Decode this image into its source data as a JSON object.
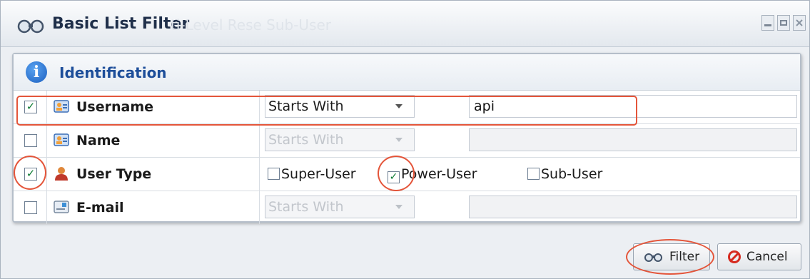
{
  "window": {
    "title": "Basic List Filter",
    "background_title": "ti-Level Rese Sub-User"
  },
  "section": {
    "title": "Identification",
    "icon": "info-icon"
  },
  "rows": [
    {
      "label": "Username",
      "checked": true,
      "icon": "user-card-icon",
      "operator": "Starts With",
      "value": "api",
      "enabled": true
    },
    {
      "label": "Name",
      "checked": false,
      "icon": "user-card-icon",
      "operator": "Starts With",
      "value": "",
      "enabled": false
    },
    {
      "label": "User Type",
      "checked": true,
      "icon": "person-icon",
      "options": [
        {
          "label": "Super-User",
          "checked": false
        },
        {
          "label": "Power-User",
          "checked": true
        },
        {
          "label": "Sub-User",
          "checked": false
        }
      ]
    },
    {
      "label": "E-mail",
      "checked": false,
      "icon": "email-icon",
      "operator": "Starts With",
      "value": "",
      "enabled": false
    }
  ],
  "buttons": {
    "filter": "Filter",
    "cancel": "Cancel"
  },
  "colors": {
    "highlight": "#e4553a",
    "section_title": "#1d4e9a",
    "check": "#0b7a32"
  }
}
